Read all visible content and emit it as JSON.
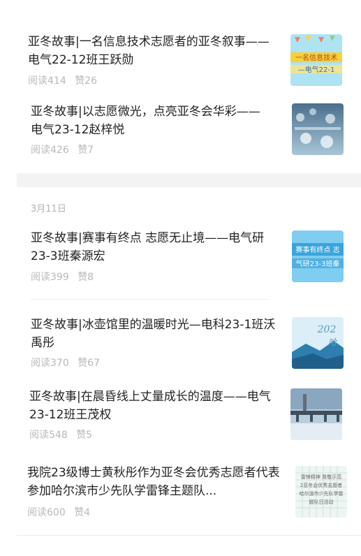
{
  "date_group": {
    "label": "3月11日"
  },
  "articles": [
    {
      "title": "亚冬故事|一名信息技术志愿者的亚冬叙事——电气22-12班王跃勋",
      "reads": "阅读414",
      "likes": "赞26",
      "thumb_text": "一名信息技术志愿者\n电气22-1"
    },
    {
      "title": "亚冬故事|以志愿微光，点亮亚冬会华彩——电气23-12赵梓悦",
      "reads": "阅读426",
      "likes": "赞7",
      "thumb_text": ""
    },
    {
      "title": "亚冬故事|赛事有终点 志愿无止境——电气研23-3班秦源宏",
      "reads": "阅读399",
      "likes": "赞8",
      "thumb_text": "赛事有终点 志愿\n气研23-3班秦源宏"
    },
    {
      "title": "亚冬故事|冰壶馆里的温暖时光—电科23-1班沃禹彤",
      "reads": "阅读370",
      "likes": "赞67",
      "thumb_text": "202"
    },
    {
      "title": "亚冬故事|在晨昏线上丈量成长的温度——电气23-12班王茂权",
      "reads": "阅读548",
      "likes": "赞5",
      "thumb_text": ""
    },
    {
      "title": "我院23级博士黄秋彤作为亚冬会优秀志愿者代表参加哈尔滨市少先队学雷锋主题队...",
      "reads": "阅读600",
      "likes": "赞4",
      "thumb_text": "雷锋精神 致敬示范榜\n作为亚冬会优秀志愿者代\n哈尔滨市少先队学雷锋\n题队日活动"
    }
  ],
  "colors": {
    "title": "#222222",
    "meta": "#b8b8b8",
    "band": "#f3f3f3"
  }
}
